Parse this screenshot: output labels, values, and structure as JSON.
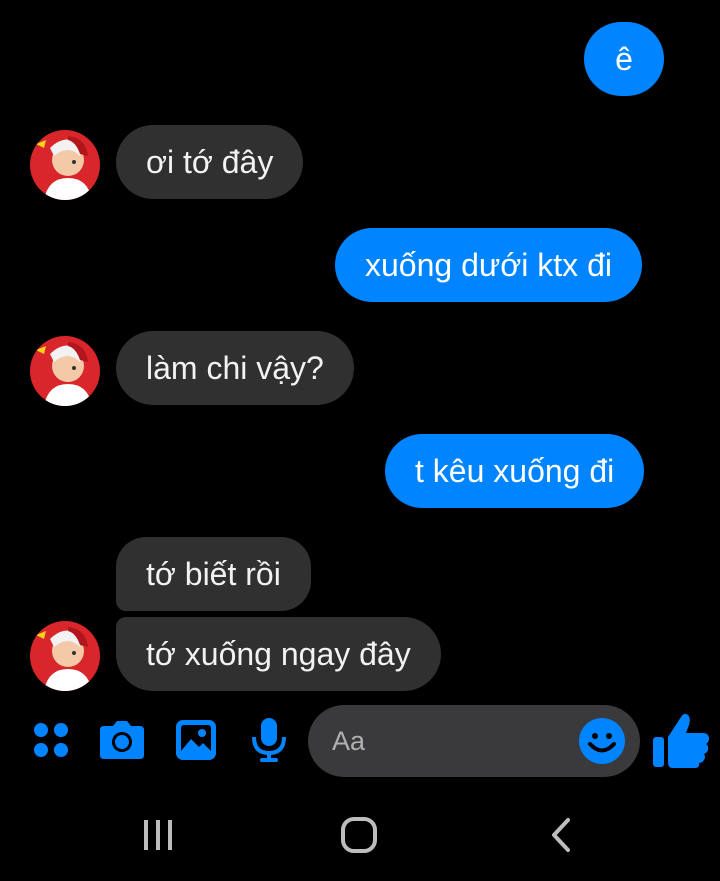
{
  "conversation": {
    "messages": [
      {
        "direction": "out",
        "text": "ê"
      },
      {
        "direction": "in",
        "text": "ơi tớ đây"
      },
      {
        "direction": "out",
        "text": "xuống dưới ktx đi"
      },
      {
        "direction": "in",
        "text": "làm chi vậy?"
      },
      {
        "direction": "out",
        "text": "t kêu xuống đi"
      },
      {
        "direction": "in",
        "text": "tớ biết rồi"
      },
      {
        "direction": "in",
        "text": "tớ xuống ngay đây"
      }
    ]
  },
  "composer": {
    "placeholder": "Aa",
    "icons": [
      "menu-dots-icon",
      "camera-icon",
      "gallery-icon",
      "microphone-icon",
      "emoji-icon",
      "thumbs-up-icon"
    ]
  },
  "navigation": {
    "icons": [
      "recent-apps-icon",
      "home-icon",
      "back-icon"
    ]
  },
  "colors": {
    "background": "#000000",
    "outgoing_bubble": "#0084ff",
    "incoming_bubble": "#303030",
    "accent": "#0084ff"
  }
}
